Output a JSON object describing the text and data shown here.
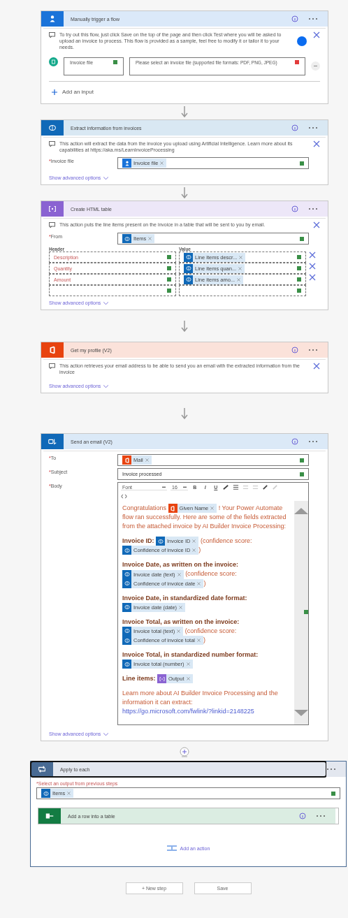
{
  "steps": [
    {
      "kind": "trigger",
      "title": "Manually trigger a flow",
      "note": "To try out this flow, just click Save on the top of the page and then click Test where you will be asked to upload an invoice to process. This flow is provided as a sample, feel free to modify it or tailor it to your needs.",
      "inputs": [
        {
          "name": "Invoice file",
          "name_error": false,
          "description": "Please select an invoice file (supported file formats: PDF, PNG, JPEG)",
          "description_error": true
        }
      ],
      "add_input": "Add an input"
    },
    {
      "kind": "ai",
      "title": "Extract information from invoices",
      "note": "This action will extract the data from the invoice you upload using Artificial Intelligence. Learn more about its capabilities at https://aka.ms/LearnInvoiceProcessing",
      "fields": [
        {
          "required_mark": "*",
          "label": "Invoice file",
          "tokens": [
            {
              "kind": "trigger",
              "text": "Invoice file"
            }
          ]
        }
      ],
      "advanced": "Show advanced options"
    },
    {
      "kind": "table",
      "title": "Create HTML table",
      "note": "This action puts the line items present on the invoice in a table that will be sent to you by email.",
      "fields": [
        {
          "required_mark": "*",
          "label": "From",
          "tokens": [
            {
              "kind": "ai",
              "text": "Items"
            }
          ]
        }
      ],
      "grid": {
        "header_label": "Header",
        "value_label": "Value",
        "rows": [
          {
            "kind": "entry",
            "header": "Description",
            "token": {
              "kind": "ai",
              "text": "Line items descr..."
            }
          },
          {
            "kind": "entry",
            "header": "Quantity",
            "token": {
              "kind": "ai",
              "text": "Line items quan..."
            }
          },
          {
            "kind": "entry",
            "header": "Amount",
            "token": {
              "kind": "ai",
              "text": "Line items amo..."
            }
          },
          {
            "kind": "empty"
          }
        ]
      },
      "advanced": "Show advanced options"
    },
    {
      "kind": "office",
      "title": "Get my profile (V2)",
      "note": "This action retrieves your email address to be able to send you an email with the extracted information from the invoice",
      "advanced": "Show advanced options"
    },
    {
      "kind": "outlook",
      "title": "Send an email (V2)",
      "fields": [
        {
          "required_mark": "*",
          "label": "To",
          "tokens": [
            {
              "kind": "office",
              "text": "Mail"
            }
          ]
        },
        {
          "required_mark": "*",
          "label": "Subject",
          "value": "Invoice processed"
        }
      ],
      "body": {
        "required_mark": "*",
        "label": "Body",
        "font": "Font",
        "size": "16",
        "toolbar": [
          "B",
          "I",
          "U"
        ],
        "paragraphs": [
          [
            {
              "kind": "text",
              "text": "Congratulations "
            },
            {
              "kind": "token",
              "token": {
                "kind": "office",
                "text": "Given Name"
              }
            },
            {
              "kind": "text",
              "text": " ! Your Power Automate flow ran successfully. Here are some of the fields extracted from the attached invoice by AI Builder Invoice Processing:"
            }
          ],
          [
            {
              "kind": "heading",
              "text": "Invoice ID:"
            },
            {
              "kind": "token",
              "token": {
                "kind": "ai",
                "text": "Invoice ID"
              }
            },
            {
              "kind": "text",
              "text": " (confidence score: "
            },
            {
              "kind": "token",
              "token": {
                "kind": "ai",
                "text": "Confidence of invoice ID"
              }
            },
            {
              "kind": "text",
              "text": ")"
            }
          ],
          [
            {
              "kind": "heading",
              "text": "Invoice Date, as written on the invoice:"
            },
            {
              "kind": "token",
              "token": {
                "kind": "ai",
                "text": "Invoice date (text)"
              }
            },
            {
              "kind": "text",
              "text": " (confidence score: "
            },
            {
              "kind": "token",
              "token": {
                "kind": "ai",
                "text": "Confidence of invoice date"
              }
            },
            {
              "kind": "text",
              "text": ")"
            }
          ],
          [
            {
              "kind": "heading",
              "text": "Invoice Date, in standardized date format:"
            },
            {
              "kind": "token",
              "token": {
                "kind": "ai",
                "text": "Invoice date (date)"
              }
            }
          ],
          [
            {
              "kind": "heading",
              "text": "Invoice Total, as written on the invoice:"
            },
            {
              "kind": "token",
              "token": {
                "kind": "ai",
                "text": "Invoice total (text)"
              }
            },
            {
              "kind": "text",
              "text": " (confidence score: "
            },
            {
              "kind": "token",
              "token": {
                "kind": "ai",
                "text": "Confidence of invoice total"
              }
            },
            {
              "kind": "text",
              "text": ")"
            }
          ],
          [
            {
              "kind": "heading",
              "text": "Invoice Total, in standardized number format:"
            },
            {
              "kind": "token",
              "token": {
                "kind": "ai",
                "text": "Invoice total (number)"
              }
            }
          ],
          [
            {
              "kind": "heading",
              "text": "Line items:"
            },
            {
              "kind": "token",
              "token": {
                "kind": "table",
                "text": "Output"
              }
            }
          ],
          [
            {
              "kind": "text",
              "text": "Learn more about AI Builder Invoice Processing and the information it can extract: "
            },
            {
              "kind": "link",
              "text": "https://go.microsoft.com/fwlink/?linkid=2148225"
            }
          ]
        ]
      },
      "advanced": "Show advanced options"
    }
  ],
  "loop": {
    "title": "Apply to each",
    "selected": true,
    "required_mark": "*",
    "label": "Select an output from previous steps",
    "tokens": [
      {
        "kind": "ai",
        "text": "Items"
      }
    ],
    "inner": {
      "kind": "excel",
      "title": "Add a row into a table"
    },
    "add_action": "Add an action"
  },
  "buttons": [
    "+ New step",
    "Save"
  ]
}
